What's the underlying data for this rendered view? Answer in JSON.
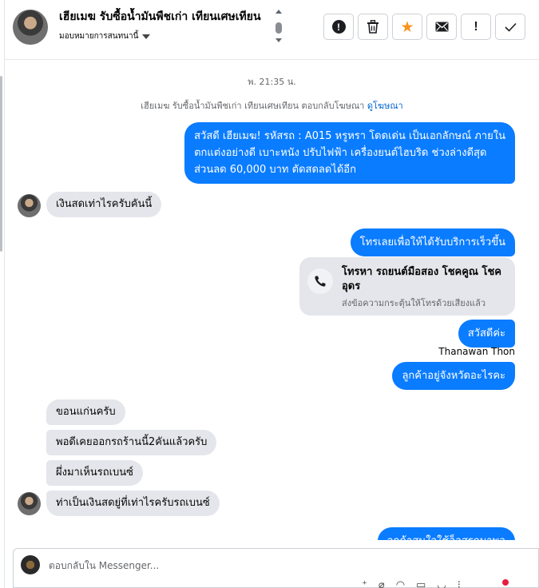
{
  "header": {
    "contact_name": "เฮียเมฆ รับซื้อน้ำมันพืชเก่า เทียนเศษเทียน",
    "assignee_label": "มอบหมายการสนทนานี้",
    "actions": {
      "warning": "warning-circle-icon",
      "delete": "trash-icon",
      "star": "star-icon",
      "mail": "envelope-icon",
      "mark": "!",
      "done": "check-icon"
    }
  },
  "conversation": {
    "timestamp": "พ. 21:35 น.",
    "system_notice": "เฮียเมฆ รับซื้อน้ำมันพืชเก่า เทียนเศษเทียน ตอบกลับโฆษณา",
    "system_link": "ดูโฆษณา",
    "messages": {
      "ad_reply_line1": "สวัสดี เฮียเมฆ! รหัสรถ : A015 หรูหรา โดดเด่น เป็นเอกลักษณ์ ภายใน",
      "ad_reply_line2": "ตกแต่งอย่างดี เบาะหนัง ปรับไฟฟ้า เครื่องยนต์ไฮบริด ช่วงล่างดีสุด",
      "ad_reply_line3": "ส่วนลด 60,000 บาท ตัดสดลดได้อีก",
      "in_cash_price": "เงินสดเท่าไรครับคันนี้",
      "out_call_prompt": "โทรเลยเพื่อให้ได้รับบริการเร็วขึ้น",
      "call_card_title": "โทรหา รถยนต์มือสอง โชคคูณ โชค อุดร",
      "call_card_subtitle": "ส่งข้อความกระตุ้นให้โทรด้วยเสียงแล้ว",
      "out_greeting": "สวัสดีค่ะ",
      "agent_name": "Thanawan Thon",
      "out_province": "ลูกค้าอยู่จังหวัดอะไรคะ",
      "in_khonkaen": "ขอนแก่นครับ",
      "in_bought_two": "พอดีเคยออกรถร้านนี้2คันแล้วครับ",
      "in_just_saw": "ผึ่งมาเห็นรถเบนซ์",
      "in_benz_cash": "ท่าเป็นเงินสดยู่ที่เท่าไรครับรถเบนซ์",
      "out_partial": "ลูกค้าสนใจใช้อ็อสรถมาพอ"
    }
  },
  "composer": {
    "placeholder": "ตอบกลับใน Messenger..."
  },
  "colors": {
    "outgoing_bubble": "#0a7cff",
    "incoming_bubble": "#e4e6eb",
    "star": "#f7931e",
    "link": "#0064d1"
  }
}
